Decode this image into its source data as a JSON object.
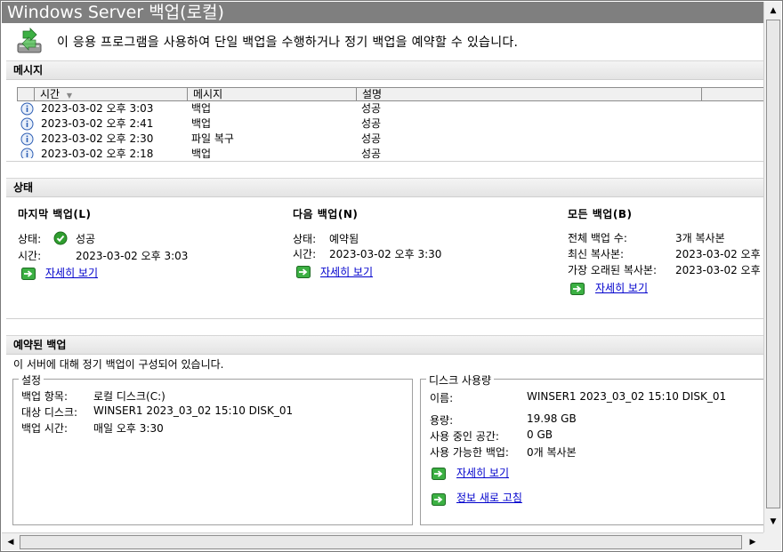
{
  "window": {
    "title": "Windows Server 백업(로컬)"
  },
  "intro": {
    "text": "이 응용 프로그램을 사용하여 단일 백업을 수행하거나 정기 백업을 예약할 수 있습니다."
  },
  "messages": {
    "header": "메시지",
    "columns": [
      "시간",
      "메시지",
      "설명"
    ],
    "rows": [
      {
        "time": "2023-03-02 오후 3:03",
        "message": "백업",
        "description": "성공"
      },
      {
        "time": "2023-03-02 오후 2:41",
        "message": "백업",
        "description": "성공"
      },
      {
        "time": "2023-03-02 오후 2:30",
        "message": "파일 복구",
        "description": "성공"
      },
      {
        "time": "2023-03-02 오후 2:18",
        "message": "백업",
        "description": "성공"
      }
    ]
  },
  "status": {
    "header": "상태",
    "last_backup": {
      "title": "마지막 백업(L)",
      "state_label": "상태:",
      "state_value": "성공",
      "time_label": "시간:",
      "time_value": "2023-03-02 오후 3:03",
      "details_link": "자세히 보기"
    },
    "next_backup": {
      "title": "다음 백업(N)",
      "state_label": "상태:",
      "state_value": "예약됨",
      "time_label": "시간:",
      "time_value": "2023-03-02 오후 3:30",
      "details_link": "자세히 보기"
    },
    "all_backups": {
      "title": "모든 백업(B)",
      "total_label": "전체 백업 수:",
      "total_value": "3개 복사본",
      "latest_label": "최신 복사본:",
      "latest_value": "2023-03-02 오후 3",
      "oldest_label": "가장 오래된 복사본:",
      "oldest_value": "2023-03-02 오후 2",
      "details_link": "자세히 보기"
    }
  },
  "scheduled": {
    "header": "예약된 백업",
    "description": "이 서버에 대해 정기 백업이 구성되어 있습니다.",
    "settings": {
      "legend": "설정",
      "items_label": "백업 항목:",
      "items_value": "로컬 디스크(C:)",
      "target_label": "대상 디스크:",
      "target_value": "WINSER1 2023_03_02 15:10 DISK_01",
      "time_label": "백업 시간:",
      "time_value": "매일 오후 3:30"
    },
    "disk_usage": {
      "legend": "디스크 사용량",
      "name_label": "이름:",
      "name_value": "WINSER1 2023_03_02 15:10 DISK_01",
      "capacity_label": "용량:",
      "capacity_value": "19.98 GB",
      "used_label": "사용 중인 공간:",
      "used_value": "0 GB",
      "available_label": "사용 가능한 백업:",
      "available_value": "0개 복사본",
      "details_link": "자세히 보기",
      "refresh_link": "정보 새로 고침"
    }
  },
  "colors": {
    "titlebar": "#7f7f7f",
    "link": "#0000cc",
    "go_icon": "#3cb043",
    "success": "#2f9e2f",
    "info": "#2e5fb4"
  }
}
